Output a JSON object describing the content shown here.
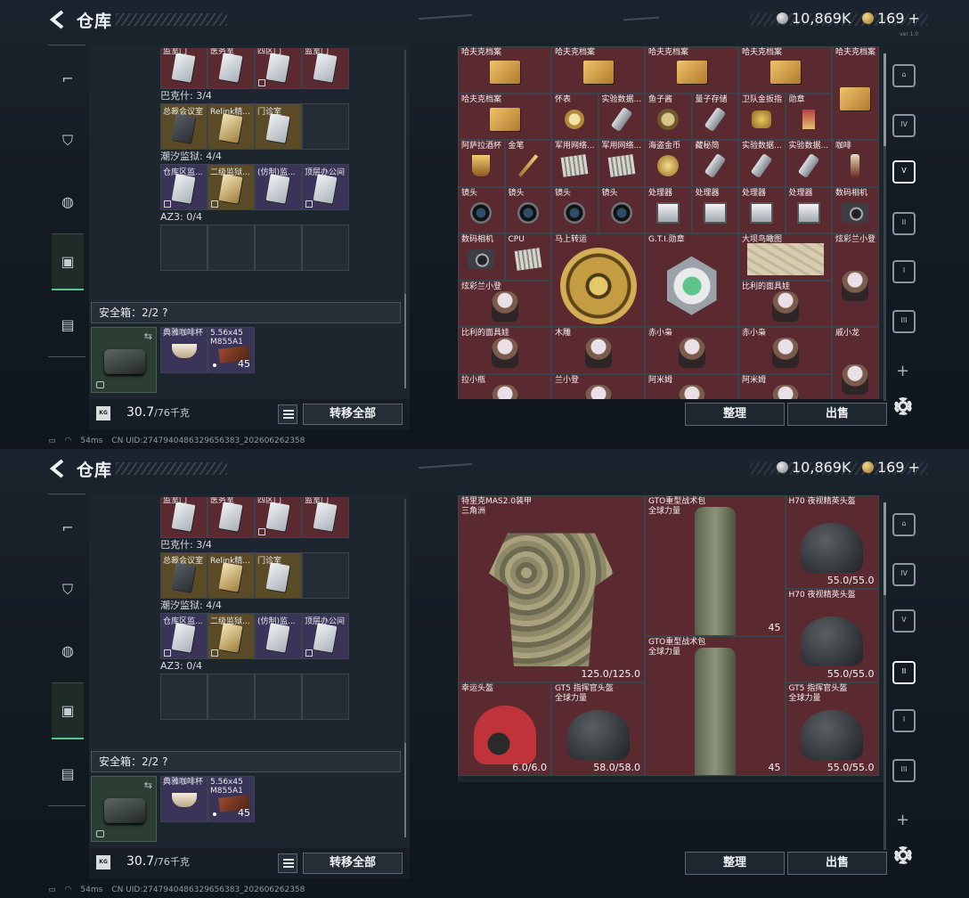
{
  "header": {
    "title": "仓库",
    "silver": "10,869K",
    "gold": "169",
    "plus": "+",
    "version": "ver 1.0"
  },
  "sidenav": [
    "gun-icon",
    "armor-icon",
    "helmet-icon",
    "backpack-icon",
    "toolbox-icon"
  ],
  "left": {
    "group_rows": [
      {
        "labels": [
          "监室门",
          "医务室",
          "四区门",
          "监室门"
        ]
      },
      {
        "title": "巴克什: 3/4",
        "labels": [
          "总裁会议室",
          "Relink精...",
          "门诊室",
          ""
        ]
      },
      {
        "title": "潮汐监狱: 4/4",
        "labels": [
          "仓库区监...",
          "二级监狱...",
          "(仿制)监...",
          "顶层办公间"
        ]
      },
      {
        "title": "AZ3: 0/4",
        "labels": [
          "",
          "",
          "",
          ""
        ]
      }
    ],
    "safe_header": "安全箱：2/2",
    "safe_help": "?",
    "safe_items": [
      {
        "label": "典雅咖啡杯"
      },
      {
        "label": "5.56x45\nM855A1",
        "count": "45"
      }
    ],
    "weight": "30.7",
    "weight_max": "/76千克",
    "transfer": "转移全部"
  },
  "right0": {
    "rows": [
      [
        "哈夫克档案",
        "哈夫克档案",
        "哈夫克档案",
        "哈夫克档案",
        "哈夫克档案"
      ],
      [
        "哈夫克档案",
        "怀表",
        "实验数据...",
        "鱼子酱",
        "量子存储",
        "卫队金扳指",
        "勋章"
      ],
      [
        "阿萨拉酒杯",
        "金笔",
        "军用网络...",
        "军用网络...",
        "海盗金币",
        "藏秘简",
        "实验数据...",
        "实验数据...",
        "咖啡"
      ],
      [
        "镜头",
        "镜头",
        "镜头",
        "镜头",
        "处理器",
        "处理器",
        "处理器",
        "处理器",
        "数码相机"
      ],
      [
        "数码相机",
        "CPU",
        "马上转运",
        "G.T.I.勋章",
        "大坝鸟瞰图",
        "炫彩兰小登"
      ],
      [
        "炫彩兰小登",
        "比利的面具娃"
      ],
      [
        "比利的面具娃",
        "木雕",
        "赤小枭",
        "赤小枭",
        "戚小龙"
      ],
      [
        "拉小瓶",
        "兰小登",
        "阿米姆",
        "阿米姆"
      ]
    ]
  },
  "right1": {
    "items": [
      {
        "name": "特里克MAS2.0装甲\n三角洲",
        "val": "125.0/125.0"
      },
      {
        "name": "GTO重型战术包\n全球力量",
        "val": "45"
      },
      {
        "name": "H70 夜视精英头盔",
        "val": "55.0/55.0"
      },
      {
        "name": "H70 夜视精英头盔",
        "val": "55.0/55.0"
      },
      {
        "name": "GTO重型战术包\n全球力量",
        "val": "45"
      },
      {
        "name": "幸运头盔",
        "val": "6.0/6.0"
      },
      {
        "name": "GT5 指挥官头盔\n全球力量",
        "val": "58.0/58.0"
      },
      {
        "name": "GT5 指挥官头盔\n全球力量",
        "val": "55.0/55.0"
      }
    ]
  },
  "buttons": {
    "sort": "整理",
    "sell": "出售"
  },
  "status": {
    "ping": "54ms",
    "uid": "CN UID:2747940486329656383_202606262358"
  },
  "colors": {
    "accent": "#57c78f",
    "red_cell": "#5b2a30",
    "gold_cell": "#5b4a26",
    "purple_cell": "#3a3558"
  }
}
